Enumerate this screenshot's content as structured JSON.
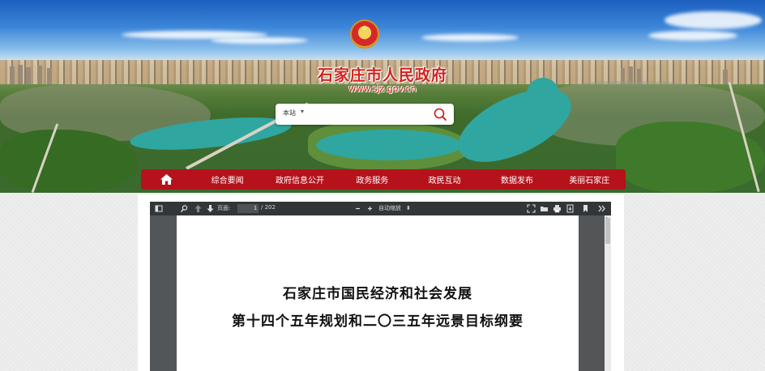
{
  "header": {
    "site_title": "石家庄市人民政府",
    "site_url": "www.sjz.gov.cn"
  },
  "search": {
    "scope": "本站",
    "value": ""
  },
  "nav": {
    "items": [
      "综合要闻",
      "政府信息公开",
      "政务服务",
      "政民互动",
      "数据发布",
      "美丽石家庄"
    ]
  },
  "viewer": {
    "page_label": "页面:",
    "current_page": "1",
    "total_pages": "/ 202",
    "zoom": "自动缩放",
    "document": {
      "title_line1": "石家庄市国民经济和社会发展",
      "title_line2": "第十四个五年规划和二〇三五年远景目标纲要"
    }
  },
  "colors": {
    "nav_red": "#b5121b",
    "title_red": "#d0241e",
    "viewer_toolbar": "#323639",
    "viewer_bg": "#525659"
  }
}
